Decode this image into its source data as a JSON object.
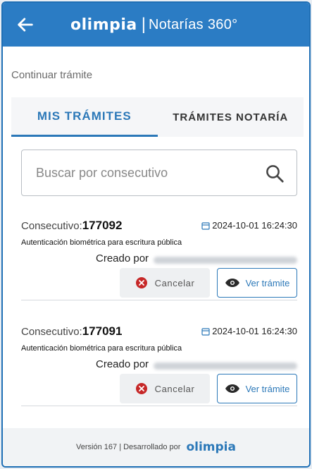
{
  "header": {
    "brand": "OLIMPIA",
    "separator": "|",
    "subtitle": "Notarías 360°"
  },
  "page": {
    "section_title": "Continuar trámite"
  },
  "tabs": [
    {
      "label": "MIS TRÁMITES",
      "active": true
    },
    {
      "label": "TRÁMITES NOTARÍA",
      "active": false
    }
  ],
  "search": {
    "placeholder": "Buscar por consecutivo",
    "value": ""
  },
  "cards": [
    {
      "consecutivo_label": "Consecutivo:",
      "consecutivo": "177092",
      "date": "2024-10-01 16:24:30",
      "description": "Autenticación biométrica para escritura pública",
      "creado_label": "Creado por",
      "cancel_label": "Cancelar",
      "view_label": "Ver trámite"
    },
    {
      "consecutivo_label": "Consecutivo:",
      "consecutivo": "177091",
      "date": "2024-10-01 16:24:30",
      "description": "Autenticación biométrica para escritura pública",
      "creado_label": "Creado por",
      "cancel_label": "Cancelar",
      "view_label": "Ver trámite"
    }
  ],
  "footer": {
    "text": "Versión 167 | Desarrollado por",
    "brand": "OLIMPIA"
  },
  "colors": {
    "primary": "#2b7cc4",
    "accent": "#2b78b8",
    "danger": "#c62828"
  },
  "icons": [
    "arrow-left-icon",
    "search-icon",
    "calendar-icon",
    "cancel-x-icon",
    "eye-icon"
  ]
}
